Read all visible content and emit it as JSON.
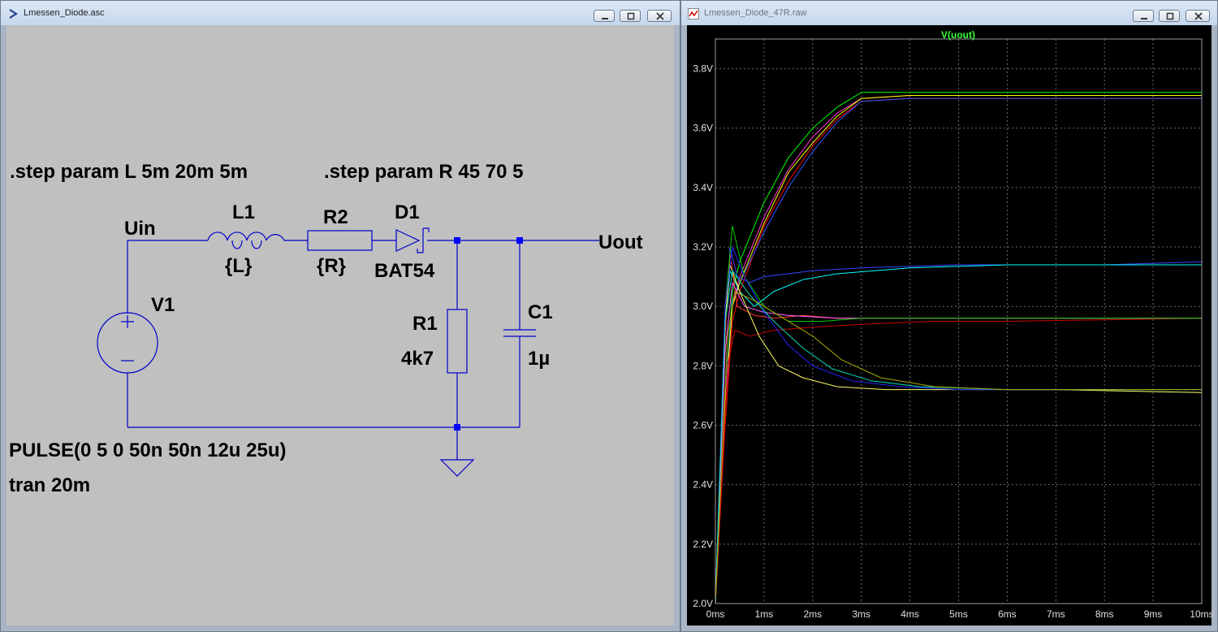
{
  "schematic_window": {
    "title": "Lmessen_Diode.asc",
    "directives": {
      "step_l": ".step param L 5m 20m 5m",
      "step_r": ".step param R 45 70 5",
      "pulse": "PULSE(0 5 0 50n 50n 12u 25u)",
      "tran": "tran 20m"
    },
    "labels": {
      "uin": "Uin",
      "uout": "Uout",
      "v1": "V1",
      "l1": "L1",
      "l1_value": "{L}",
      "r2": "R2",
      "r2_value": "{R}",
      "d1": "D1",
      "d1_value": "BAT54",
      "r1": "R1",
      "r1_value": "4k7",
      "c1": "C1",
      "c1_value": "1µ"
    },
    "colors": {
      "wire": "#0000cc",
      "junction": "#0000ff",
      "background": "#c0c0c0"
    }
  },
  "plot_window": {
    "title": "Lmessen_Diode_47R.raw",
    "trace_name": "V(uout)",
    "colors": {
      "background": "#000000",
      "grid": "#6a6a6a",
      "trace_label": "#33ff33"
    }
  },
  "window_controls": {
    "minimize": "minimize-icon",
    "maximize": "maximize-icon",
    "close": "close-icon"
  },
  "chart_data": {
    "type": "line",
    "title": "V(uout)",
    "xlabel": "",
    "ylabel": "",
    "x_unit": "ms",
    "y_unit": "V",
    "xlim": [
      0,
      10
    ],
    "ylim": [
      2.0,
      3.9
    ],
    "x_ticks": [
      "0ms",
      "1ms",
      "2ms",
      "3ms",
      "4ms",
      "5ms",
      "6ms",
      "7ms",
      "8ms",
      "9ms",
      "10ms"
    ],
    "y_ticks": [
      "2.0V",
      "2.2V",
      "2.4V",
      "2.6V",
      "2.8V",
      "3.0V",
      "3.2V",
      "3.4V",
      "3.6V",
      "3.8V"
    ],
    "y_tick_values": [
      2.0,
      2.2,
      2.4,
      2.6,
      2.8,
      3.0,
      3.2,
      3.4,
      3.6,
      3.8
    ],
    "grid": true,
    "legend": "none",
    "series": [
      {
        "color": "#00ff00",
        "x": [
          0,
          0.2,
          0.35,
          0.5,
          1,
          1.5,
          2,
          2.5,
          3,
          4,
          6,
          10
        ],
        "y": [
          2.0,
          2.7,
          3.05,
          3.15,
          3.35,
          3.5,
          3.6,
          3.67,
          3.72,
          3.72,
          3.72,
          3.72
        ]
      },
      {
        "color": "#ff33cc",
        "x": [
          0,
          0.2,
          0.35,
          0.5,
          1,
          1.5,
          2,
          2.5,
          3,
          4,
          6,
          10
        ],
        "y": [
          2.0,
          2.65,
          3.0,
          3.1,
          3.3,
          3.46,
          3.57,
          3.65,
          3.7,
          3.71,
          3.71,
          3.71
        ]
      },
      {
        "color": "#ff0000",
        "x": [
          0,
          0.2,
          0.35,
          0.5,
          1,
          1.5,
          2,
          2.5,
          3,
          4,
          6,
          10
        ],
        "y": [
          2.0,
          2.6,
          2.95,
          3.05,
          3.27,
          3.42,
          3.54,
          3.63,
          3.69,
          3.7,
          3.7,
          3.7
        ]
      },
      {
        "color": "#3355ff",
        "x": [
          0,
          0.2,
          0.35,
          0.5,
          1,
          1.5,
          2,
          2.5,
          3,
          4,
          6,
          10
        ],
        "y": [
          2.0,
          2.7,
          3.02,
          3.08,
          3.25,
          3.4,
          3.52,
          3.62,
          3.69,
          3.7,
          3.7,
          3.7
        ]
      },
      {
        "color": "#ffff00",
        "x": [
          0,
          0.2,
          0.35,
          0.5,
          1,
          1.5,
          2,
          2.5,
          3,
          4,
          6,
          10
        ],
        "y": [
          2.0,
          2.68,
          3.0,
          3.08,
          3.28,
          3.45,
          3.55,
          3.64,
          3.7,
          3.71,
          3.71,
          3.71
        ]
      },
      {
        "color": "#3344ff",
        "x": [
          0,
          0.2,
          0.3,
          0.45,
          0.7,
          1,
          1.5,
          2,
          3,
          5,
          8,
          10
        ],
        "y": [
          2.0,
          2.9,
          3.2,
          3.1,
          3.08,
          3.1,
          3.11,
          3.12,
          3.13,
          3.14,
          3.14,
          3.15
        ]
      },
      {
        "color": "#00ffff",
        "x": [
          0,
          0.2,
          0.3,
          0.5,
          0.8,
          1.2,
          1.8,
          2.5,
          4,
          6,
          10
        ],
        "y": [
          2.0,
          2.95,
          3.12,
          3.05,
          3.0,
          3.05,
          3.09,
          3.11,
          3.13,
          3.14,
          3.14
        ]
      },
      {
        "color": "#ff3333",
        "x": [
          0,
          0.2,
          0.3,
          0.45,
          0.8,
          1.2,
          1.8,
          2.5,
          4,
          6,
          10
        ],
        "y": [
          2.0,
          2.9,
          3.18,
          3.0,
          2.97,
          2.96,
          2.97,
          2.96,
          2.96,
          2.96,
          2.96
        ]
      },
      {
        "color": "#cc0000",
        "x": [
          0,
          0.25,
          0.4,
          0.7,
          1.2,
          2,
          3,
          4.5,
          6,
          10
        ],
        "y": [
          2.0,
          2.8,
          2.92,
          2.9,
          2.92,
          2.93,
          2.94,
          2.95,
          2.95,
          2.96
        ]
      },
      {
        "color": "#ff66ff",
        "x": [
          0,
          0.2,
          0.35,
          0.6,
          1,
          1.5,
          2.5,
          4,
          10
        ],
        "y": [
          2.0,
          2.85,
          3.08,
          3.0,
          2.98,
          2.97,
          2.96,
          2.96,
          2.96
        ]
      },
      {
        "color": "#00cc00",
        "x": [
          0,
          0.2,
          0.35,
          0.6,
          1,
          1.5,
          2.2,
          3,
          5,
          10
        ],
        "y": [
          2.0,
          3.0,
          3.27,
          3.1,
          3.0,
          2.95,
          2.95,
          2.96,
          2.96,
          2.96
        ]
      },
      {
        "color": "#ffff66",
        "x": [
          0,
          0.2,
          0.3,
          0.5,
          0.9,
          1.3,
          1.8,
          2.5,
          3.5,
          5,
          7,
          10
        ],
        "y": [
          2.0,
          2.95,
          3.14,
          3.05,
          2.9,
          2.8,
          2.76,
          2.73,
          2.72,
          2.72,
          2.72,
          2.71
        ]
      },
      {
        "color": "#2222ff",
        "x": [
          0,
          0.2,
          0.35,
          0.6,
          1,
          1.5,
          2,
          2.8,
          3.8,
          5,
          7,
          10
        ],
        "y": [
          2.0,
          3.0,
          3.2,
          3.1,
          2.98,
          2.87,
          2.8,
          2.75,
          2.73,
          2.72,
          2.72,
          2.72
        ]
      },
      {
        "color": "#00ddbb",
        "x": [
          0,
          0.2,
          0.35,
          0.7,
          1.2,
          1.8,
          2.4,
          3.2,
          4.2,
          6,
          10
        ],
        "y": [
          2.0,
          2.95,
          3.12,
          3.04,
          2.95,
          2.86,
          2.79,
          2.75,
          2.73,
          2.72,
          2.72
        ]
      },
      {
        "color": "#aaaa00",
        "x": [
          0,
          0.25,
          0.4,
          0.8,
          1.3,
          2,
          2.6,
          3.4,
          4.5,
          6,
          10
        ],
        "y": [
          2.0,
          2.9,
          3.05,
          3.02,
          2.97,
          2.9,
          2.82,
          2.76,
          2.73,
          2.72,
          2.72
        ]
      }
    ]
  }
}
